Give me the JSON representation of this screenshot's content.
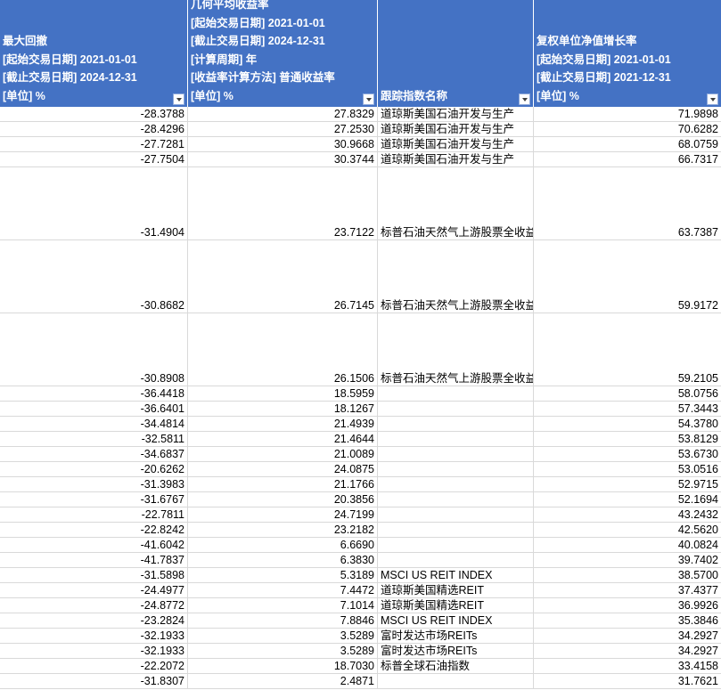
{
  "header": {
    "col1": [
      "最大回撤",
      "[起始交易日期] 2021-01-01",
      "[截止交易日期] 2024-12-31",
      "[单位] %"
    ],
    "col2": [
      "几何平均收益率",
      "[起始交易日期] 2021-01-01",
      "[截止交易日期] 2024-12-31",
      "[计算周期] 年",
      "[收益率计算方法] 普通收益率",
      "[单位] %"
    ],
    "col3": [
      "跟踪指数名称"
    ],
    "col4": [
      "复权单位净值增长率",
      "[起始交易日期] 2021-01-01",
      "[截止交易日期] 2021-12-31",
      "[单位] %"
    ]
  },
  "rows": [
    {
      "drawdown": "-28.3788",
      "geo_return": "27.8329",
      "index_name": "道琼斯美国石油开发与生产",
      "nav_growth": "71.9898",
      "tall": false
    },
    {
      "drawdown": "-28.4296",
      "geo_return": "27.2530",
      "index_name": "道琼斯美国石油开发与生产",
      "nav_growth": "70.6282",
      "tall": false
    },
    {
      "drawdown": "-27.7281",
      "geo_return": "30.9668",
      "index_name": "道琼斯美国石油开发与生产",
      "nav_growth": "68.0759",
      "tall": false
    },
    {
      "drawdown": "-27.7504",
      "geo_return": "30.3744",
      "index_name": "道琼斯美国石油开发与生产",
      "nav_growth": "66.7317",
      "tall": false
    },
    {
      "drawdown": "-31.4904",
      "geo_return": "23.7122",
      "index_name": "标普石油天然气上游股票全收益",
      "nav_growth": "63.7387",
      "tall": true
    },
    {
      "drawdown": "-30.8682",
      "geo_return": "26.7145",
      "index_name": "标普石油天然气上游股票全收益",
      "nav_growth": "59.9172",
      "tall": true
    },
    {
      "drawdown": "-30.8908",
      "geo_return": "26.1506",
      "index_name": "标普石油天然气上游股票全收益",
      "nav_growth": "59.2105",
      "tall": true
    },
    {
      "drawdown": "-36.4418",
      "geo_return": "18.5959",
      "index_name": "",
      "nav_growth": "58.0756",
      "tall": false
    },
    {
      "drawdown": "-36.6401",
      "geo_return": "18.1267",
      "index_name": "",
      "nav_growth": "57.3443",
      "tall": false
    },
    {
      "drawdown": "-34.4814",
      "geo_return": "21.4939",
      "index_name": "",
      "nav_growth": "54.3780",
      "tall": false
    },
    {
      "drawdown": "-32.5811",
      "geo_return": "21.4644",
      "index_name": "",
      "nav_growth": "53.8129",
      "tall": false
    },
    {
      "drawdown": "-34.6837",
      "geo_return": "21.0089",
      "index_name": "",
      "nav_growth": "53.6730",
      "tall": false
    },
    {
      "drawdown": "-20.6262",
      "geo_return": "24.0875",
      "index_name": "",
      "nav_growth": "53.0516",
      "tall": false
    },
    {
      "drawdown": "-31.3983",
      "geo_return": "21.1766",
      "index_name": "",
      "nav_growth": "52.9715",
      "tall": false
    },
    {
      "drawdown": "-31.6767",
      "geo_return": "20.3856",
      "index_name": "",
      "nav_growth": "52.1694",
      "tall": false
    },
    {
      "drawdown": "-22.7811",
      "geo_return": "24.7199",
      "index_name": "",
      "nav_growth": "43.2432",
      "tall": false
    },
    {
      "drawdown": "-22.8242",
      "geo_return": "23.2182",
      "index_name": "",
      "nav_growth": "42.5620",
      "tall": false
    },
    {
      "drawdown": "-41.6042",
      "geo_return": "6.6690",
      "index_name": "",
      "nav_growth": "40.0824",
      "tall": false
    },
    {
      "drawdown": "-41.7837",
      "geo_return": "6.3830",
      "index_name": "",
      "nav_growth": "39.7402",
      "tall": false
    },
    {
      "drawdown": "-31.5898",
      "geo_return": "5.3189",
      "index_name": "MSCI US REIT INDEX",
      "nav_growth": "38.5700",
      "tall": false
    },
    {
      "drawdown": "-24.4977",
      "geo_return": "7.4472",
      "index_name": "道琼斯美国精选REIT",
      "nav_growth": "37.4377",
      "tall": false
    },
    {
      "drawdown": "-24.8772",
      "geo_return": "7.1014",
      "index_name": "道琼斯美国精选REIT",
      "nav_growth": "36.9926",
      "tall": false
    },
    {
      "drawdown": "-23.2824",
      "geo_return": "7.8846",
      "index_name": "MSCI US REIT INDEX",
      "nav_growth": "35.3846",
      "tall": false
    },
    {
      "drawdown": "-32.1933",
      "geo_return": "3.5289",
      "index_name": "富时发达市场REITs",
      "nav_growth": "34.2927",
      "tall": false
    },
    {
      "drawdown": "-32.1933",
      "geo_return": "3.5289",
      "index_name": "富时发达市场REITs",
      "nav_growth": "34.2927",
      "tall": false
    },
    {
      "drawdown": "-22.2072",
      "geo_return": "18.7030",
      "index_name": "标普全球石油指数",
      "nav_growth": "33.4158",
      "tall": false
    },
    {
      "drawdown": "-31.8307",
      "geo_return": "2.4871",
      "index_name": "",
      "nav_growth": "31.7621",
      "tall": false
    }
  ]
}
